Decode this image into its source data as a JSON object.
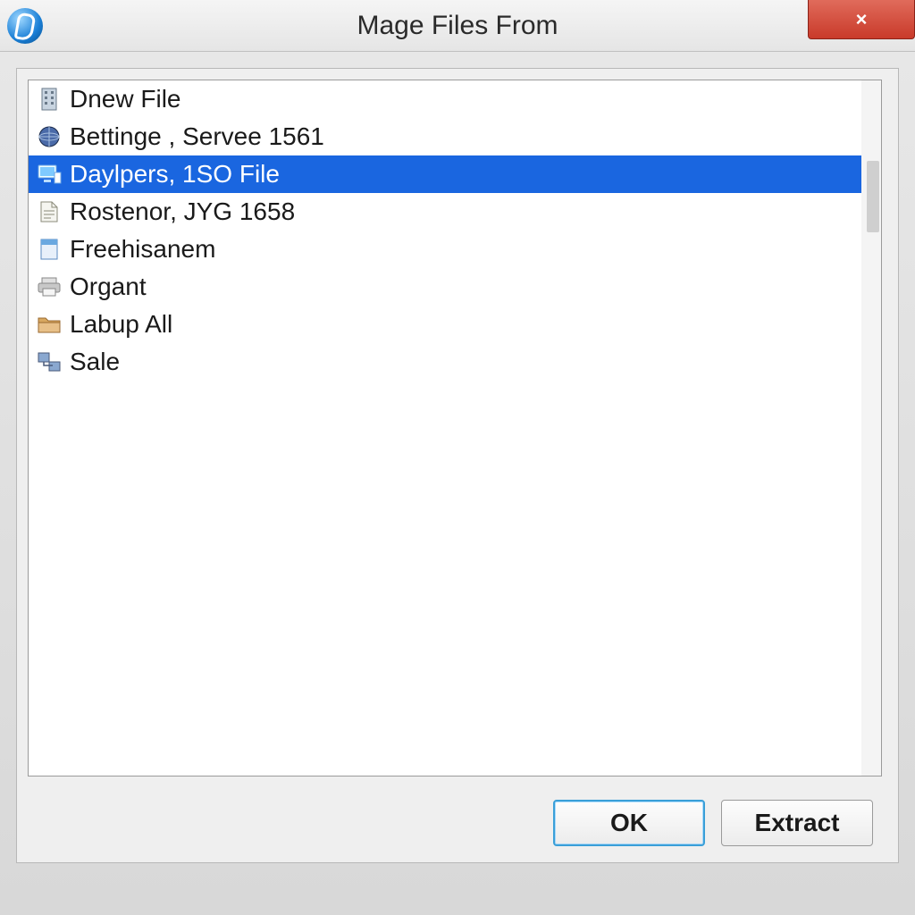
{
  "window": {
    "title": "Mage Files From",
    "close_label": "×"
  },
  "list": {
    "items": [
      {
        "label": "Dnew File",
        "icon": "building-icon",
        "selected": false
      },
      {
        "label": "Bettinge , Servee 1561",
        "icon": "globe-icon",
        "selected": false
      },
      {
        "label": "Daylpers, 1SO File",
        "icon": "computer-icon",
        "selected": true
      },
      {
        "label": "Rostenor, JYG 1658",
        "icon": "document-icon",
        "selected": false
      },
      {
        "label": "Freehisanem",
        "icon": "page-icon",
        "selected": false
      },
      {
        "label": "Organt",
        "icon": "printer-icon",
        "selected": false
      },
      {
        "label": "Labup All",
        "icon": "folder-icon",
        "selected": false
      },
      {
        "label": "Sale",
        "icon": "network-icon",
        "selected": false
      }
    ]
  },
  "buttons": {
    "ok": "OK",
    "extract": "Extract"
  }
}
